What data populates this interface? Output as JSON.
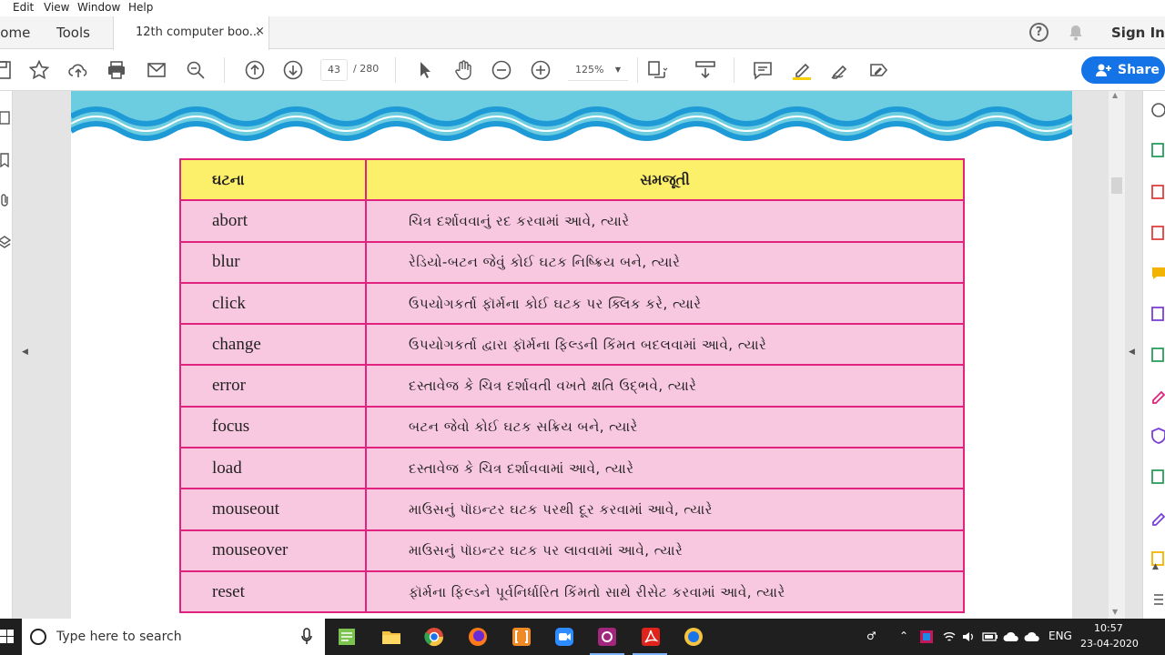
{
  "menu": {
    "items": [
      "Edit",
      "View",
      "Window",
      "Help"
    ]
  },
  "nav": {
    "home": "Home",
    "tools": "Tools"
  },
  "tab": {
    "title": "12th computer boo...",
    "close": "×"
  },
  "header": {
    "help": "?",
    "sign_in": "Sign In"
  },
  "toolbar": {
    "page_current": "43",
    "page_total": "/  280",
    "zoom": "125%",
    "share": "Share"
  },
  "table": {
    "headers": {
      "event": "ઘટના",
      "description": "સમજૂતી"
    },
    "rows": [
      {
        "event": "abort",
        "description": "ચિત્ર દર્શાવવાનું રદ કરવામાં આવે, ત્યારે"
      },
      {
        "event": "blur",
        "description": "રેડિયો-બટન જેવું કોઈ ઘટક નિષ્ક્રિય બને, ત્યારે"
      },
      {
        "event": "click",
        "description": "ઉપયોગકર્તા ફૉર્મના કોઈ ઘટક પર ક્લિક કરે, ત્યારે"
      },
      {
        "event": "change",
        "description": "ઉપયોગકર્તા દ્વારા ફૉર્મના ફિલ્ડની કિંમત બદલવામાં આવે, ત્યારે"
      },
      {
        "event": "error",
        "description": "દસ્તાવેજ કે ચિત્ર દર્શાવતી વખતે ક્ષતિ ઉદ્ભવે, ત્યારે"
      },
      {
        "event": "focus",
        "description": "બટન જેવો કોઈ ઘટક સક્રિય બને, ત્યારે"
      },
      {
        "event": "load",
        "description": "દસ્તાવેજ કે ચિત્ર દર્શાવવામાં આવે, ત્યારે"
      },
      {
        "event": "mouseout",
        "description": "માઉસનું પૉઇન્ટર ઘટક પરથી દૂર કરવામાં આવે, ત્યારે"
      },
      {
        "event": "mouseover",
        "description": "માઉસનું પૉઇન્ટર ઘટક પર લાવવામાં આવે, ત્યારે"
      },
      {
        "event": "reset",
        "description": "ફૉર્મના ફિલ્ડને પૂર્વનિર્ધારિત કિંમતો સાથે રીસેટ કરવામાં આવે, ત્યારે"
      }
    ]
  },
  "taskbar": {
    "search_placeholder": "Type here to search",
    "language": "ENG",
    "time": "10:57",
    "date": "23-04-2020"
  },
  "colors": {
    "table_header": "#fcef6a",
    "table_row": "#f8c7e0",
    "table_border": "#e0237e",
    "wave": "#1e9ad6",
    "share_button": "#1473e6"
  }
}
